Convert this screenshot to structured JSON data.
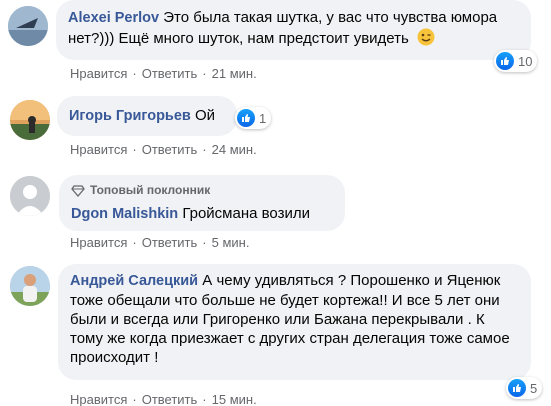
{
  "comments": [
    {
      "author": "Alexei Perlov",
      "text": "Это была такая шутка, у вас что чувства юмора нет?))) Ещё много шуток, нам предстоит увидеть",
      "emoji": "wink-emoji",
      "like_label": "Нравится",
      "reply_label": "Ответить",
      "time": "21 мин.",
      "reactions": "10"
    },
    {
      "author": "Игорь Григорьев",
      "text": "Ой",
      "like_label": "Нравится",
      "reply_label": "Ответить",
      "time": "24 мин.",
      "reactions": "1"
    },
    {
      "badge": "Топовый поклонник",
      "author": "Dgon Malishkin",
      "text": "Гройсмана возили",
      "like_label": "Нравится",
      "reply_label": "Ответить",
      "time": "5 мин."
    },
    {
      "author": "Андрей Салецкий",
      "text": "А чему удивляться ? Порошенко и Яценюк тоже обещали что больше не будет кортежа!! И все 5 лет они были и всегда или Григоренко или Бажана перекрывали . К тому же когда приезжает с других стран делегация тоже самое происходит !",
      "like_label": "Нравится",
      "reply_label": "Ответить",
      "time": "15 мин.",
      "reactions": "5"
    }
  ],
  "colors": {
    "author": "#385898",
    "bubble": "#f0f2f5",
    "meta": "#65676b",
    "like": "#1877f2"
  }
}
